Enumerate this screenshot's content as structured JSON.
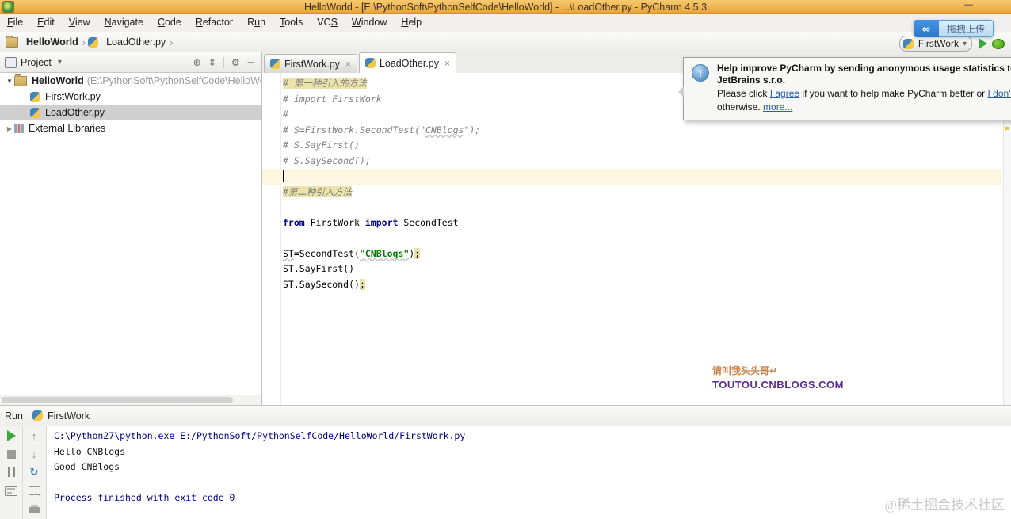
{
  "window": {
    "title": "HelloWorld - [E:\\PythonSoft\\PythonSelfCode\\HelloWorld] - ...\\LoadOther.py - PyCharm 4.5.3",
    "minimize_glyph": "—"
  },
  "glyphs": {
    "chevron": "›",
    "dropdown": "▾",
    "tree_open": "▼",
    "tree_closed": "▶",
    "close": "×",
    "gear": "⚙",
    "target": "⊕",
    "updown": "⇕",
    "hide": "⊣",
    "up": "↑",
    "down": "↓",
    "rerun": "↻",
    "infinity": "∞",
    "info_mark": "!"
  },
  "menu": {
    "items": [
      {
        "label": "File",
        "m": 0
      },
      {
        "label": "Edit",
        "m": 0
      },
      {
        "label": "View",
        "m": 0
      },
      {
        "label": "Navigate",
        "m": 0
      },
      {
        "label": "Code",
        "m": 0
      },
      {
        "label": "Refactor",
        "m": 0
      },
      {
        "label": "Run",
        "m": 1
      },
      {
        "label": "Tools",
        "m": 0
      },
      {
        "label": "VCS",
        "m": 2
      },
      {
        "label": "Window",
        "m": 0
      },
      {
        "label": "Help",
        "m": 0
      }
    ]
  },
  "overlay": {
    "upload_label": "拖拽上传"
  },
  "navbar": {
    "breadcrumbs": [
      {
        "label": "HelloWorld",
        "icon": "folder",
        "bold": true
      },
      {
        "label": "LoadOther.py",
        "icon": "python",
        "bold": false
      }
    ],
    "run_config": "FirstWork"
  },
  "project": {
    "header": "Project",
    "root_name": "HelloWorld",
    "root_path": "(E:\\PythonSoft\\PythonSelfCode\\HelloWorld)",
    "files": [
      {
        "name": "FirstWork.py",
        "selected": false
      },
      {
        "name": "LoadOther.py",
        "selected": true
      }
    ],
    "external_libraries": "External Libraries"
  },
  "editor": {
    "tabs": [
      {
        "label": "FirstWork.py",
        "active": false
      },
      {
        "label": "LoadOther.py",
        "active": true
      }
    ],
    "code": [
      {
        "tokens": [
          [
            "chl",
            "# 第一种引入的方法"
          ]
        ]
      },
      {
        "tokens": [
          [
            "c",
            "# import FirstWork"
          ]
        ]
      },
      {
        "tokens": [
          [
            "c",
            "#"
          ]
        ]
      },
      {
        "tokens": [
          [
            "c",
            "# S=FirstWork.SecondTest(\""
          ],
          [
            "c typo",
            "CNBlogs"
          ],
          [
            "c",
            "\");"
          ]
        ]
      },
      {
        "tokens": [
          [
            "c",
            "# S.SayFirst()"
          ]
        ]
      },
      {
        "tokens": [
          [
            "c",
            "# S.SaySecond();"
          ]
        ]
      },
      {
        "caret": true,
        "tokens": []
      },
      {
        "tokens": [
          [
            "chl",
            "#第二种引入方法"
          ]
        ]
      },
      {
        "tokens": []
      },
      {
        "tokens": [
          [
            "k",
            "from"
          ],
          [
            "pl",
            " FirstWork "
          ],
          [
            "k",
            "import"
          ],
          [
            "pl",
            " SecondTest"
          ]
        ]
      },
      {
        "tokens": []
      },
      {
        "tokens": [
          [
            "pl typo",
            "ST"
          ],
          [
            "pl",
            "=SecondTest("
          ],
          [
            "s typo",
            "\"CNBlogs\""
          ],
          [
            "pl",
            ")"
          ],
          [
            "warn",
            ";"
          ]
        ]
      },
      {
        "tokens": [
          [
            "pl",
            "ST.SayFirst()"
          ]
        ]
      },
      {
        "tokens": [
          [
            "pl",
            "ST.SaySecond()"
          ],
          [
            "warn",
            ";"
          ]
        ]
      }
    ],
    "watermark": {
      "line1": "请叫我头头哥↵",
      "line2": "TOUTOU.CNBLOGS.COM"
    }
  },
  "notification": {
    "title_line1": "Help improve PyCharm by sending anonymous usage statistics to",
    "title_line2": "JetBrains s.r.o.",
    "body_line1": [
      {
        "t": "Please click "
      },
      {
        "t": "I agree",
        "link": true
      },
      {
        "t": " if you want to help make PyCharm better or "
      },
      {
        "t": "I don't agree",
        "link": true
      }
    ],
    "body_line2": [
      {
        "t": "otherwise. "
      },
      {
        "t": "more...",
        "link": true
      }
    ]
  },
  "run": {
    "tab_label": "Run",
    "config": "FirstWork",
    "console": [
      {
        "cls": "sys",
        "text": "C:\\Python27\\python.exe E:/PythonSoft/PythonSelfCode/HelloWorld/FirstWork.py"
      },
      {
        "cls": "out",
        "text": "Hello CNBlogs"
      },
      {
        "cls": "out",
        "text": "Good CNBlogs"
      },
      {
        "cls": "out",
        "text": ""
      },
      {
        "cls": "sys",
        "text": "Process finished with exit code 0"
      }
    ]
  },
  "page_watermark": "@稀土掘金技术社区",
  "colors": {
    "titlebar": "#eca93f",
    "keyword": "#000080",
    "string": "#008000",
    "comment": "#808080",
    "highlight": "#ece3ab",
    "caret_row": "#fdf6e0",
    "link": "#2a5caa",
    "selection": "#cfcfcf"
  }
}
